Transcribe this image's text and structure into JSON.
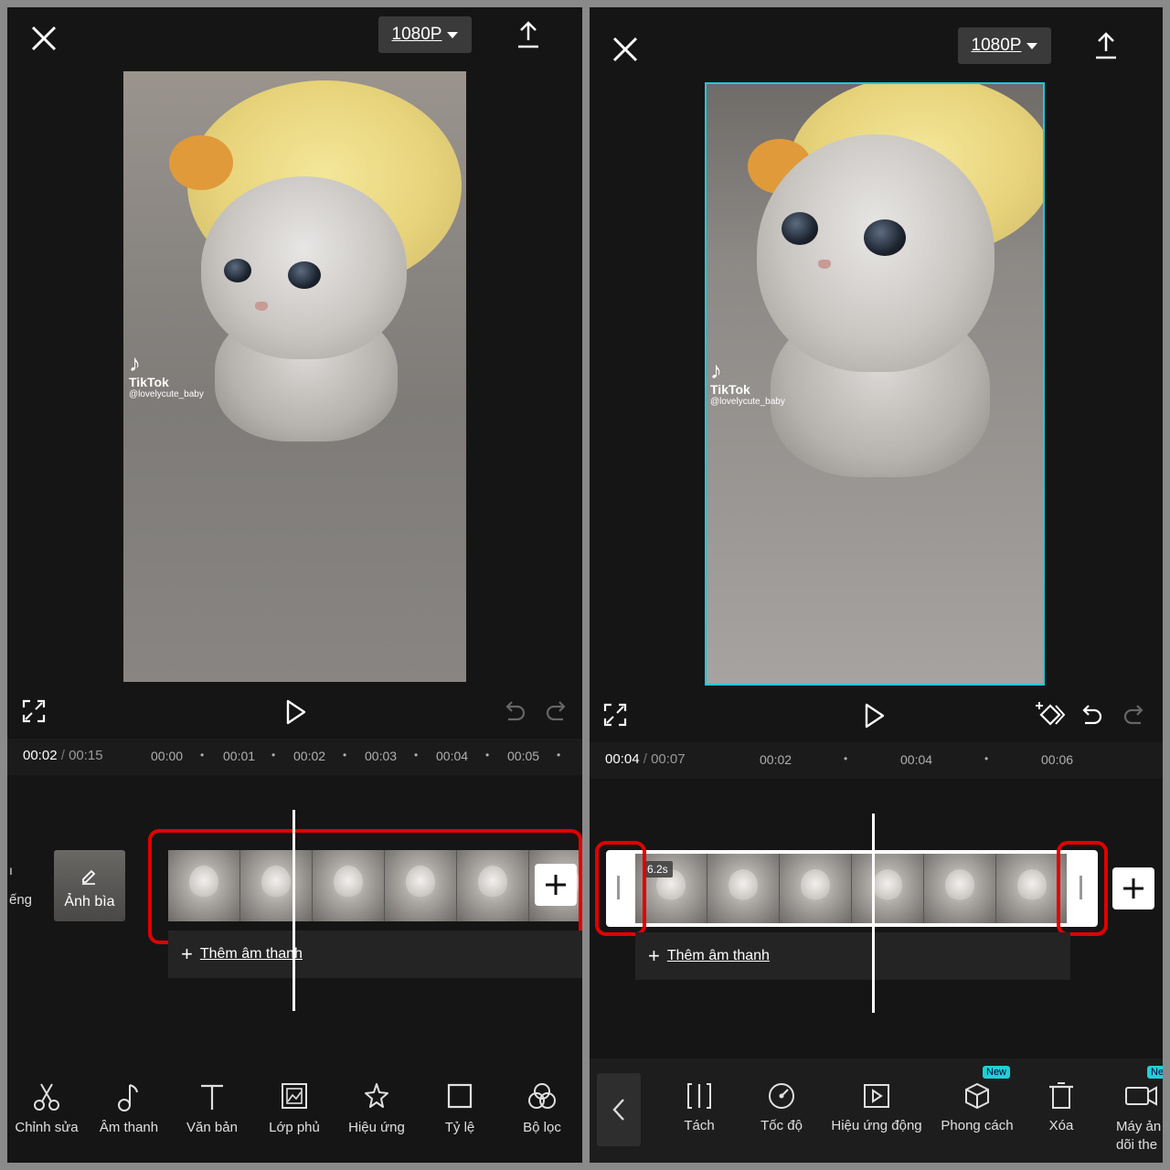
{
  "left": {
    "resolution": "1080P",
    "watermark": {
      "brand": "TikTok",
      "handle": "@lovelycute_baby"
    },
    "time": {
      "current": "00:02",
      "separator": "/",
      "total": "00:15"
    },
    "ruler": [
      "00:00",
      "00:01",
      "00:02",
      "00:03",
      "00:04",
      "00:05"
    ],
    "side_label": "ếng",
    "cover_label": "Ảnh bìa",
    "add_audio": "Thêm âm thanh",
    "tools": [
      "Chỉnh sửa",
      "Âm thanh",
      "Văn bản",
      "Lớp phủ",
      "Hiệu ứng",
      "Tỷ lệ",
      "Bộ lọc"
    ]
  },
  "right": {
    "resolution": "1080P",
    "watermark": {
      "brand": "TikTok",
      "handle": "@lovelycute_baby"
    },
    "time": {
      "current": "00:04",
      "separator": "/",
      "total": "00:07"
    },
    "ruler": [
      "00:02",
      "00:04",
      "00:06"
    ],
    "clip_duration": "6.2s",
    "add_audio": "Thêm âm thanh",
    "tools": [
      "Tách",
      "Tốc độ",
      "Hiệu ứng động",
      "Phong cách",
      "Xóa",
      "Máy ản",
      "dõi the"
    ],
    "new_badge": "New"
  },
  "colors": {
    "highlight_red": "#e00000",
    "selection_cyan": "#1fc8dc",
    "badge": "#1fd0d8"
  }
}
